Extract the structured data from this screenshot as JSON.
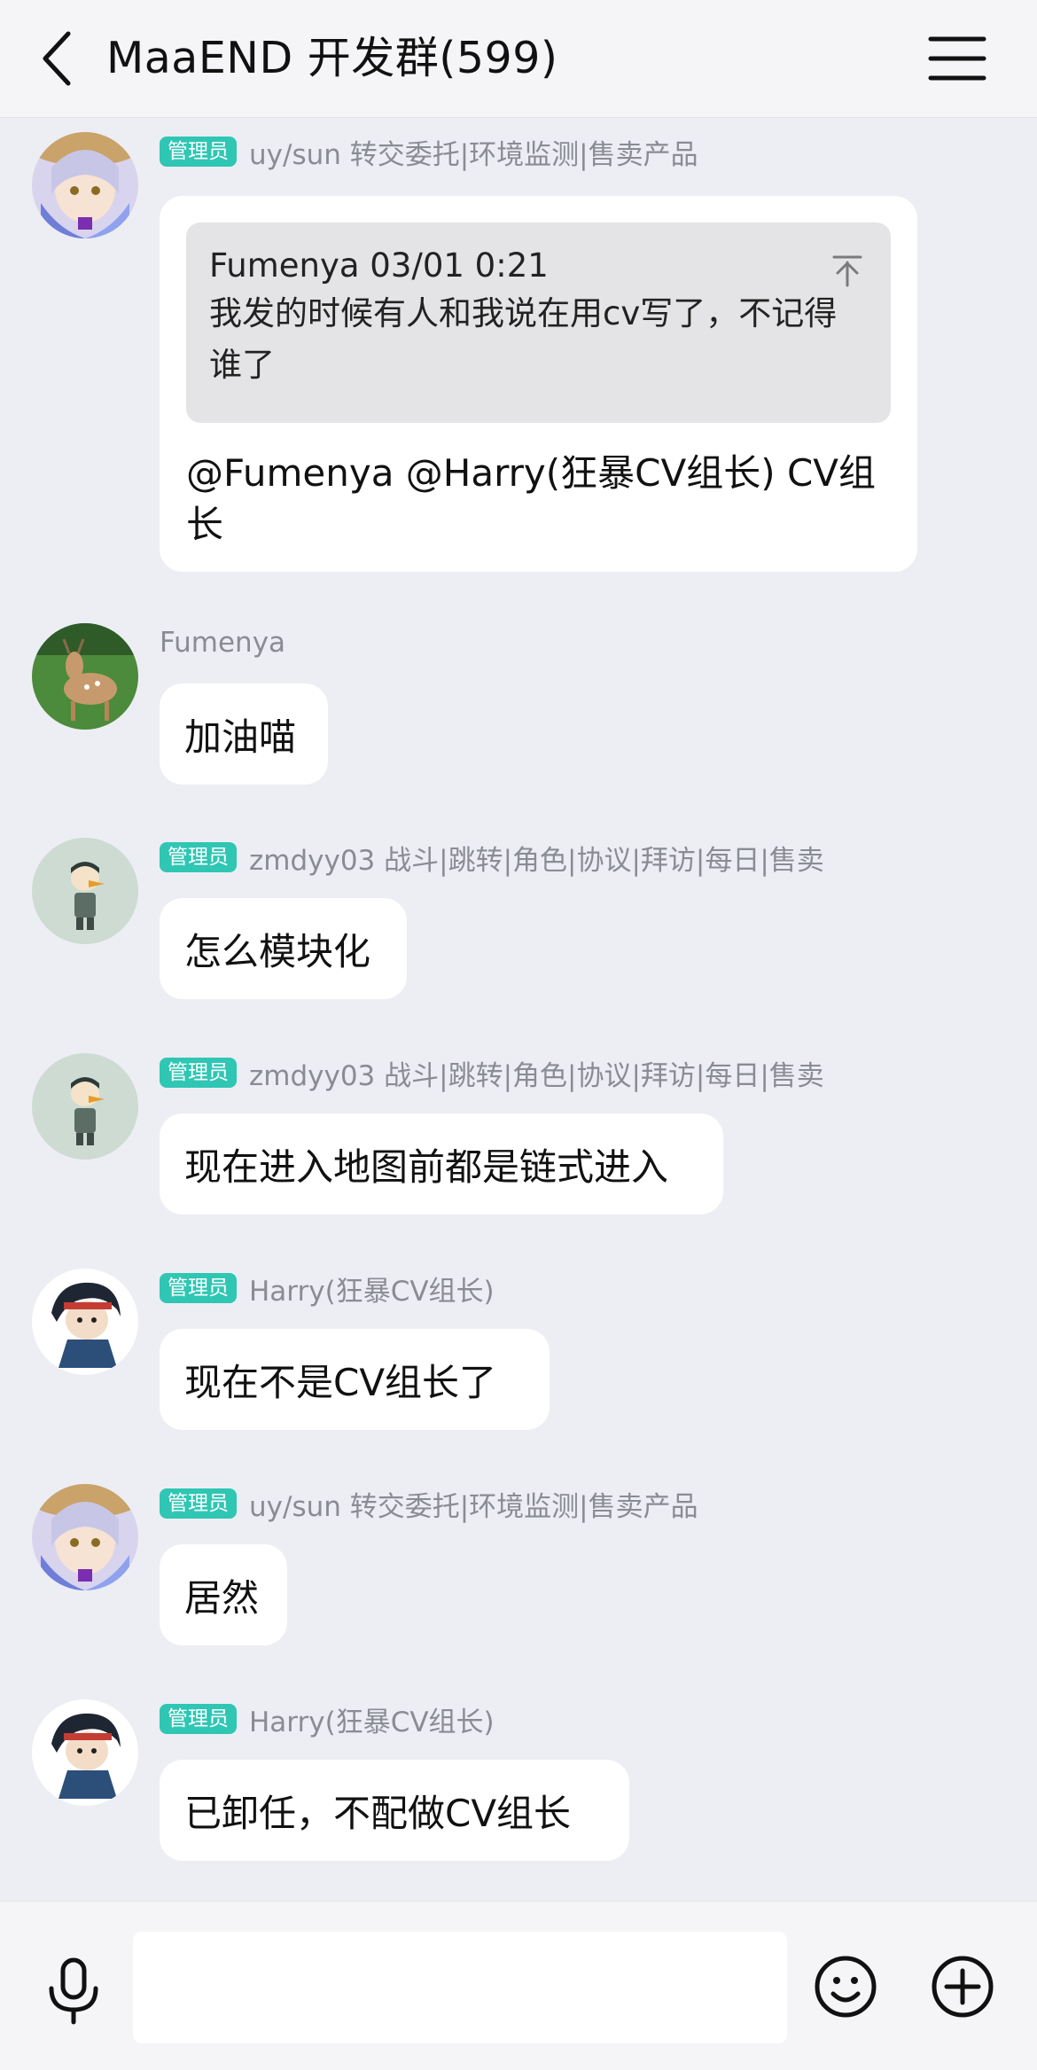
{
  "header": {
    "title": "MaaEND 开发群(599)"
  },
  "admin_badge": "管理员",
  "messages": [
    {
      "sender": "uy/sun 转交委托|环境监测|售卖产品",
      "admin": true,
      "quote": {
        "author_time": "Fumenya 03/01 0:21",
        "text": "我发的时候有人和我说在用cv写了，不记得谁了"
      },
      "text": "@Fumenya @Harry(狂暴CV组长) CV组长"
    },
    {
      "sender": "Fumenya",
      "admin": false,
      "text": "加油喵"
    },
    {
      "sender": "zmdyy03 战斗|跳转|角色|协议|拜访|每日|售卖",
      "admin": true,
      "text": "怎么模块化"
    },
    {
      "sender": "zmdyy03 战斗|跳转|角色|协议|拜访|每日|售卖",
      "admin": true,
      "text": "现在进入地图前都是链式进入"
    },
    {
      "sender": "Harry(狂暴CV组长)",
      "admin": true,
      "text": "现在不是CV组长了"
    },
    {
      "sender": "uy/sun 转交委托|环境监测|售卖产品",
      "admin": true,
      "text": "居然"
    },
    {
      "sender": "Harry(狂暴CV组长)",
      "admin": true,
      "text": "已卸任，不配做CV组长"
    }
  ],
  "input": {
    "value": "",
    "placeholder": ""
  },
  "colors": {
    "background": "#edeef3",
    "header": "#f5f5f8",
    "badge": "#2fc6b4",
    "bubble": "#ffffff",
    "quote": "#e4e4e6",
    "sender_text": "#8a8c94"
  },
  "icons": {
    "back": "chevron-left-icon",
    "menu": "hamburger-menu-icon",
    "quote_jump": "jump-to-top-icon",
    "voice": "microphone-icon",
    "emoji": "smiley-icon",
    "more": "plus-circle-icon"
  }
}
